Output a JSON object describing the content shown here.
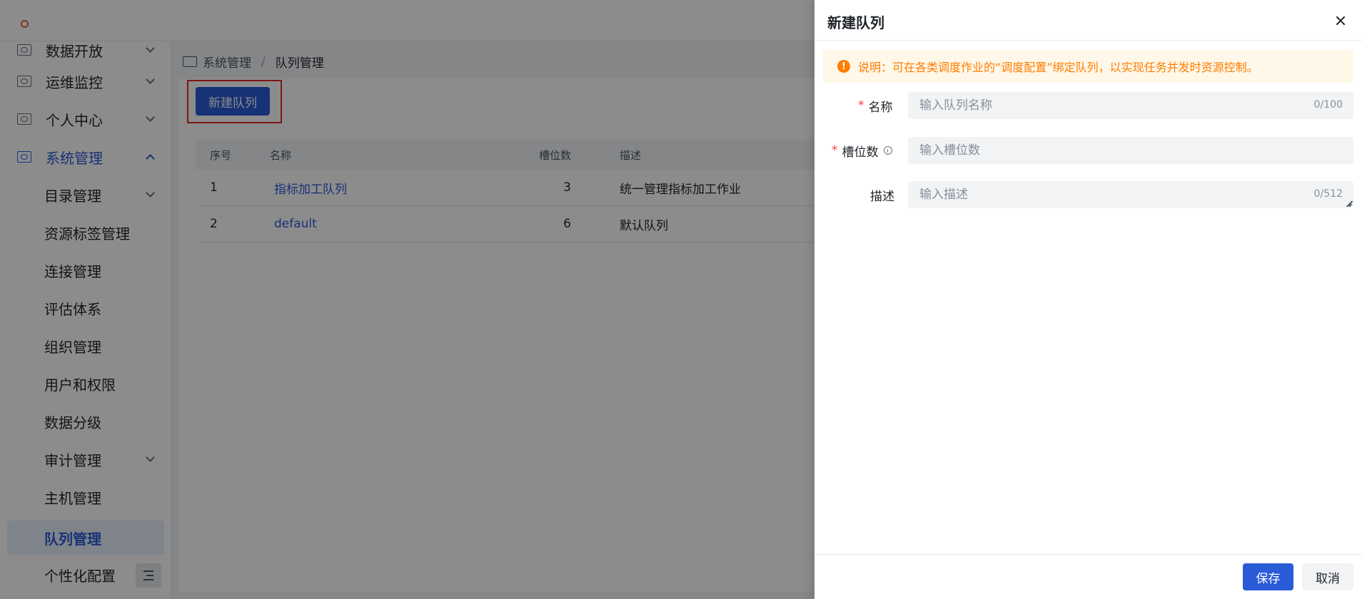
{
  "sidebar": {
    "menu": [
      {
        "label": "数据开放",
        "icon": "data-open-icon"
      },
      {
        "label": "运维监控",
        "icon": "monitor-icon"
      },
      {
        "label": "个人中心",
        "icon": "profile-icon"
      },
      {
        "label": "系统管理",
        "icon": "system-icon"
      }
    ],
    "sub_items": [
      {
        "label": "目录管理"
      },
      {
        "label": "资源标签管理"
      },
      {
        "label": "连接管理"
      },
      {
        "label": "评估体系"
      },
      {
        "label": "组织管理"
      },
      {
        "label": "用户和权限"
      },
      {
        "label": "数据分级"
      },
      {
        "label": "审计管理"
      },
      {
        "label": "主机管理"
      },
      {
        "label": "队列管理"
      },
      {
        "label": "个性化配置"
      }
    ],
    "selected": "队列管理"
  },
  "breadcrumb": {
    "parent": "系统管理",
    "separator": "/",
    "current": "队列管理"
  },
  "toolbar": {
    "create_label": "新建队列"
  },
  "table": {
    "headers": [
      "序号",
      "名称",
      "槽位数",
      "描述"
    ],
    "rows": [
      {
        "idx": "1",
        "name": "指标加工队列",
        "slots": "3",
        "desc": "统一管理指标加工作业"
      },
      {
        "idx": "2",
        "name": "default",
        "slots": "6",
        "desc": "默认队列"
      }
    ]
  },
  "drawer": {
    "title": "新建队列",
    "notice": "说明：可在各类调度作业的“调度配置”绑定队列，以实现任务并发时资源控制。",
    "notice_icon": "!",
    "fields": {
      "name": {
        "label": "名称",
        "placeholder": "输入队列名称",
        "counter": "0/100",
        "required": true
      },
      "slots": {
        "label": "槽位数",
        "placeholder": "输入槽位数",
        "required": true
      },
      "desc": {
        "label": "描述",
        "placeholder": "输入描述",
        "counter": "0/512",
        "required": false
      }
    },
    "required_mark": "*",
    "save_label": "保存",
    "cancel_label": "取消"
  },
  "colors": {
    "primary": "#2a5bd7",
    "warning": "#ff7d00",
    "danger": "#f53f3f",
    "highlight": "#e32b2b"
  }
}
